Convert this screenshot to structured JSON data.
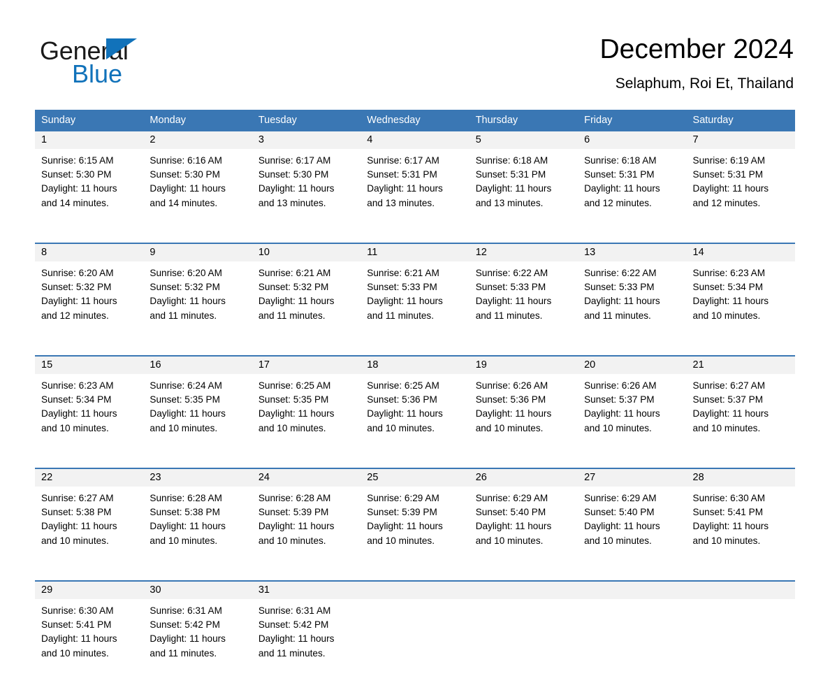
{
  "brand": {
    "name_dark": "General",
    "name_light": "Blue",
    "accent_color": "#1172ba"
  },
  "header": {
    "title": "December 2024",
    "subtitle": "Selaphum, Roi Et, Thailand"
  },
  "calendar": {
    "header_bg": "#3a77b4",
    "date_band_bg": "#f2f2f2",
    "weekdays": [
      "Sunday",
      "Monday",
      "Tuesday",
      "Wednesday",
      "Thursday",
      "Friday",
      "Saturday"
    ],
    "weeks": [
      {
        "days": [
          {
            "date": "1",
            "sunrise": "Sunrise: 6:15 AM",
            "sunset": "Sunset: 5:30 PM",
            "daylight_1": "Daylight: 11 hours",
            "daylight_2": "and 14 minutes."
          },
          {
            "date": "2",
            "sunrise": "Sunrise: 6:16 AM",
            "sunset": "Sunset: 5:30 PM",
            "daylight_1": "Daylight: 11 hours",
            "daylight_2": "and 14 minutes."
          },
          {
            "date": "3",
            "sunrise": "Sunrise: 6:17 AM",
            "sunset": "Sunset: 5:30 PM",
            "daylight_1": "Daylight: 11 hours",
            "daylight_2": "and 13 minutes."
          },
          {
            "date": "4",
            "sunrise": "Sunrise: 6:17 AM",
            "sunset": "Sunset: 5:31 PM",
            "daylight_1": "Daylight: 11 hours",
            "daylight_2": "and 13 minutes."
          },
          {
            "date": "5",
            "sunrise": "Sunrise: 6:18 AM",
            "sunset": "Sunset: 5:31 PM",
            "daylight_1": "Daylight: 11 hours",
            "daylight_2": "and 13 minutes."
          },
          {
            "date": "6",
            "sunrise": "Sunrise: 6:18 AM",
            "sunset": "Sunset: 5:31 PM",
            "daylight_1": "Daylight: 11 hours",
            "daylight_2": "and 12 minutes."
          },
          {
            "date": "7",
            "sunrise": "Sunrise: 6:19 AM",
            "sunset": "Sunset: 5:31 PM",
            "daylight_1": "Daylight: 11 hours",
            "daylight_2": "and 12 minutes."
          }
        ]
      },
      {
        "days": [
          {
            "date": "8",
            "sunrise": "Sunrise: 6:20 AM",
            "sunset": "Sunset: 5:32 PM",
            "daylight_1": "Daylight: 11 hours",
            "daylight_2": "and 12 minutes."
          },
          {
            "date": "9",
            "sunrise": "Sunrise: 6:20 AM",
            "sunset": "Sunset: 5:32 PM",
            "daylight_1": "Daylight: 11 hours",
            "daylight_2": "and 11 minutes."
          },
          {
            "date": "10",
            "sunrise": "Sunrise: 6:21 AM",
            "sunset": "Sunset: 5:32 PM",
            "daylight_1": "Daylight: 11 hours",
            "daylight_2": "and 11 minutes."
          },
          {
            "date": "11",
            "sunrise": "Sunrise: 6:21 AM",
            "sunset": "Sunset: 5:33 PM",
            "daylight_1": "Daylight: 11 hours",
            "daylight_2": "and 11 minutes."
          },
          {
            "date": "12",
            "sunrise": "Sunrise: 6:22 AM",
            "sunset": "Sunset: 5:33 PM",
            "daylight_1": "Daylight: 11 hours",
            "daylight_2": "and 11 minutes."
          },
          {
            "date": "13",
            "sunrise": "Sunrise: 6:22 AM",
            "sunset": "Sunset: 5:33 PM",
            "daylight_1": "Daylight: 11 hours",
            "daylight_2": "and 11 minutes."
          },
          {
            "date": "14",
            "sunrise": "Sunrise: 6:23 AM",
            "sunset": "Sunset: 5:34 PM",
            "daylight_1": "Daylight: 11 hours",
            "daylight_2": "and 10 minutes."
          }
        ]
      },
      {
        "days": [
          {
            "date": "15",
            "sunrise": "Sunrise: 6:23 AM",
            "sunset": "Sunset: 5:34 PM",
            "daylight_1": "Daylight: 11 hours",
            "daylight_2": "and 10 minutes."
          },
          {
            "date": "16",
            "sunrise": "Sunrise: 6:24 AM",
            "sunset": "Sunset: 5:35 PM",
            "daylight_1": "Daylight: 11 hours",
            "daylight_2": "and 10 minutes."
          },
          {
            "date": "17",
            "sunrise": "Sunrise: 6:25 AM",
            "sunset": "Sunset: 5:35 PM",
            "daylight_1": "Daylight: 11 hours",
            "daylight_2": "and 10 minutes."
          },
          {
            "date": "18",
            "sunrise": "Sunrise: 6:25 AM",
            "sunset": "Sunset: 5:36 PM",
            "daylight_1": "Daylight: 11 hours",
            "daylight_2": "and 10 minutes."
          },
          {
            "date": "19",
            "sunrise": "Sunrise: 6:26 AM",
            "sunset": "Sunset: 5:36 PM",
            "daylight_1": "Daylight: 11 hours",
            "daylight_2": "and 10 minutes."
          },
          {
            "date": "20",
            "sunrise": "Sunrise: 6:26 AM",
            "sunset": "Sunset: 5:37 PM",
            "daylight_1": "Daylight: 11 hours",
            "daylight_2": "and 10 minutes."
          },
          {
            "date": "21",
            "sunrise": "Sunrise: 6:27 AM",
            "sunset": "Sunset: 5:37 PM",
            "daylight_1": "Daylight: 11 hours",
            "daylight_2": "and 10 minutes."
          }
        ]
      },
      {
        "days": [
          {
            "date": "22",
            "sunrise": "Sunrise: 6:27 AM",
            "sunset": "Sunset: 5:38 PM",
            "daylight_1": "Daylight: 11 hours",
            "daylight_2": "and 10 minutes."
          },
          {
            "date": "23",
            "sunrise": "Sunrise: 6:28 AM",
            "sunset": "Sunset: 5:38 PM",
            "daylight_1": "Daylight: 11 hours",
            "daylight_2": "and 10 minutes."
          },
          {
            "date": "24",
            "sunrise": "Sunrise: 6:28 AM",
            "sunset": "Sunset: 5:39 PM",
            "daylight_1": "Daylight: 11 hours",
            "daylight_2": "and 10 minutes."
          },
          {
            "date": "25",
            "sunrise": "Sunrise: 6:29 AM",
            "sunset": "Sunset: 5:39 PM",
            "daylight_1": "Daylight: 11 hours",
            "daylight_2": "and 10 minutes."
          },
          {
            "date": "26",
            "sunrise": "Sunrise: 6:29 AM",
            "sunset": "Sunset: 5:40 PM",
            "daylight_1": "Daylight: 11 hours",
            "daylight_2": "and 10 minutes."
          },
          {
            "date": "27",
            "sunrise": "Sunrise: 6:29 AM",
            "sunset": "Sunset: 5:40 PM",
            "daylight_1": "Daylight: 11 hours",
            "daylight_2": "and 10 minutes."
          },
          {
            "date": "28",
            "sunrise": "Sunrise: 6:30 AM",
            "sunset": "Sunset: 5:41 PM",
            "daylight_1": "Daylight: 11 hours",
            "daylight_2": "and 10 minutes."
          }
        ]
      },
      {
        "days": [
          {
            "date": "29",
            "sunrise": "Sunrise: 6:30 AM",
            "sunset": "Sunset: 5:41 PM",
            "daylight_1": "Daylight: 11 hours",
            "daylight_2": "and 10 minutes."
          },
          {
            "date": "30",
            "sunrise": "Sunrise: 6:31 AM",
            "sunset": "Sunset: 5:42 PM",
            "daylight_1": "Daylight: 11 hours",
            "daylight_2": "and 11 minutes."
          },
          {
            "date": "31",
            "sunrise": "Sunrise: 6:31 AM",
            "sunset": "Sunset: 5:42 PM",
            "daylight_1": "Daylight: 11 hours",
            "daylight_2": "and 11 minutes."
          },
          {
            "date": "",
            "sunrise": "",
            "sunset": "",
            "daylight_1": "",
            "daylight_2": ""
          },
          {
            "date": "",
            "sunrise": "",
            "sunset": "",
            "daylight_1": "",
            "daylight_2": ""
          },
          {
            "date": "",
            "sunrise": "",
            "sunset": "",
            "daylight_1": "",
            "daylight_2": ""
          },
          {
            "date": "",
            "sunrise": "",
            "sunset": "",
            "daylight_1": "",
            "daylight_2": ""
          }
        ]
      }
    ]
  }
}
